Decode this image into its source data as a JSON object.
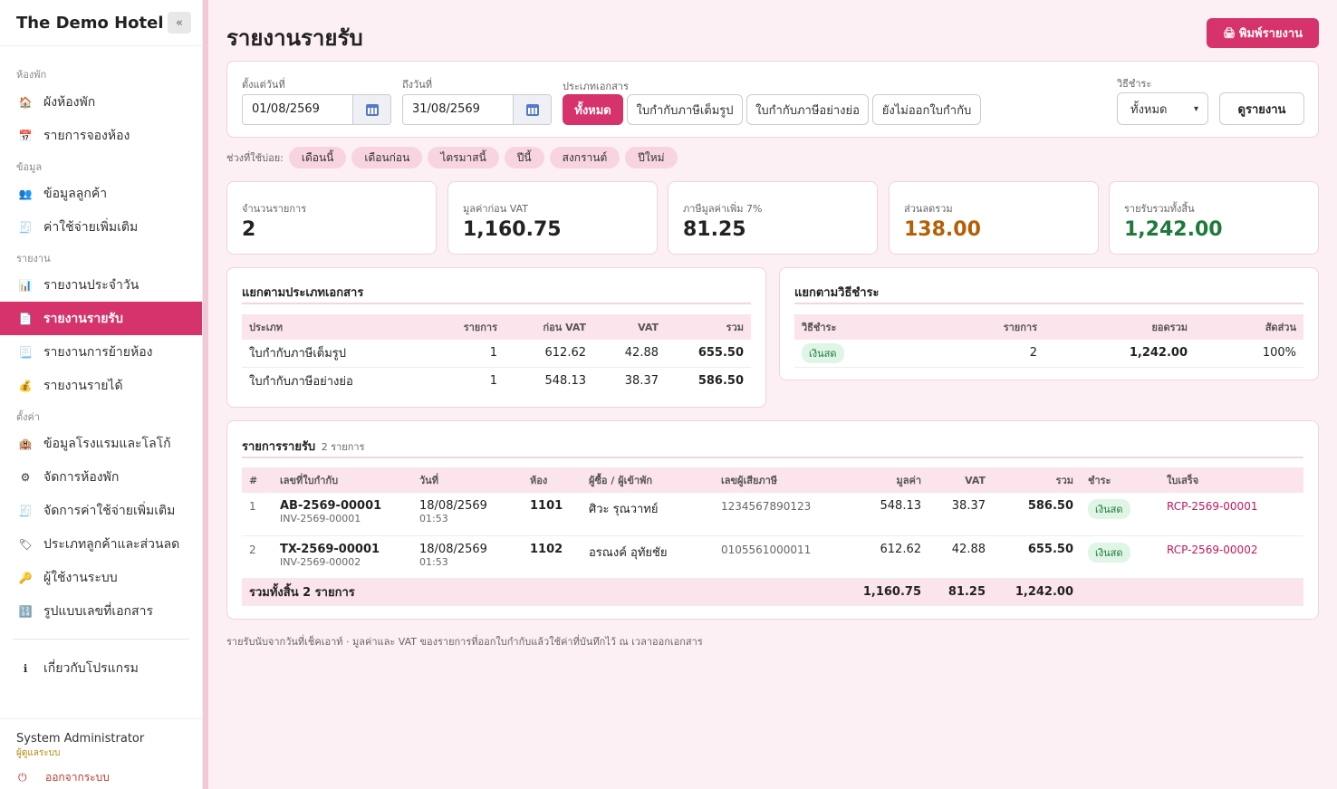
{
  "sidebar": {
    "brand": "The Demo Hotel",
    "collapse": "«",
    "sections": {
      "rooms": "ห้องพัก",
      "data": "ข้อมูล",
      "reports": "รายงาน",
      "settings": "ตั้งค่า"
    },
    "items": {
      "room_chart": "ผังห้องพัก",
      "bookings": "รายการจองห้อง",
      "customers": "ข้อมูลลูกค้า",
      "extra_costs": "ค่าใช้จ่ายเพิ่มเติม",
      "daily_report": "รายงานประจำวัน",
      "receipts_report": "รายงานรายรับ",
      "room_move_report": "รายงานการย้ายห้อง",
      "income_report": "รายงานรายได้",
      "hotel_info": "ข้อมูลโรงแรมและโลโก้",
      "manage_rooms": "จัดการห้องพัก",
      "manage_extra": "จัดการค่าใช้จ่ายเพิ่มเติม",
      "customer_types": "ประเภทลูกค้าและส่วนลด",
      "users": "ผู้ใช้งานระบบ",
      "doc_numbering": "รูปแบบเลขที่เอกสาร",
      "about": "เกี่ยวกับโปรแกรม"
    },
    "user_name": "System Administrator",
    "user_role": "ผู้ดูแลระบบ",
    "logout": "ออกจากระบบ"
  },
  "page": {
    "title": "รายงานรายรับ",
    "print_button": "พิมพ์รายงาน"
  },
  "filters": {
    "from_label": "ตั้งแต่วันที่",
    "from_value": "01/08/2569",
    "to_label": "ถึงวันที่",
    "to_value": "31/08/2569",
    "doc_type_label": "ประเภทเอกสาร",
    "doc_types": [
      "ทั้งหมด",
      "ใบกำกับภาษีเต็มรูป",
      "ใบกำกับภาษีอย่างย่อ",
      "ยังไม่ออกใบกำกับ"
    ],
    "payment_label": "วิธีชำระ",
    "payment_value": "ทั้งหมด",
    "run_button": "ดูรายงาน"
  },
  "quick": {
    "label": "ช่วงที่ใช้บ่อย:",
    "chips": [
      "เดือนนี้",
      "เดือนก่อน",
      "ไตรมาสนี้",
      "ปีนี้",
      "สงกรานต์",
      "ปีใหม่"
    ]
  },
  "stats": [
    {
      "label": "จำนวนรายการ",
      "value": "2",
      "color": "#222222"
    },
    {
      "label": "มูลค่าก่อน VAT",
      "value": "1,160.75",
      "color": "#222222"
    },
    {
      "label": "ภาษีมูลค่าเพิ่ม 7%",
      "value": "81.25",
      "color": "#222222"
    },
    {
      "label": "ส่วนลดรวม",
      "value": "138.00",
      "color": "#b45f06"
    },
    {
      "label": "รายรับรวมทั้งสิ้น",
      "value": "1,242.00",
      "color": "#1e7a3c"
    }
  ],
  "by_doc_type": {
    "title": "แยกตามประเภทเอกสาร",
    "headers": [
      "ประเภท",
      "รายการ",
      "ก่อน VAT",
      "VAT",
      "รวม"
    ],
    "rows": [
      [
        "ใบกำกับภาษีเต็มรูป",
        "1",
        "612.62",
        "42.88",
        "655.50"
      ],
      [
        "ใบกำกับภาษีอย่างย่อ",
        "1",
        "548.13",
        "38.37",
        "586.50"
      ]
    ]
  },
  "by_payment": {
    "title": "แยกตามวิธีชำระ",
    "headers": [
      "วิธีชำระ",
      "รายการ",
      "ยอดรวม",
      "สัดส่วน"
    ],
    "rows": [
      [
        "เงินสด",
        "2",
        "1,242.00",
        "100%"
      ]
    ]
  },
  "receipts": {
    "title": "รายการรายรับ",
    "count_label": "2 รายการ",
    "headers": [
      "#",
      "เลขที่ใบกำกับ",
      "วันที่",
      "ห้อง",
      "ผู้ซื้อ / ผู้เข้าพัก",
      "เลขผู้เสียภาษี",
      "มูลค่า",
      "VAT",
      "รวม",
      "ชำระ",
      "ใบเสร็จ"
    ],
    "rows": [
      {
        "no": "1",
        "doc": "AB-2569-00001",
        "inv": "INV-2569-00001",
        "date": "18/08/2569",
        "time": "01:53",
        "room": "1101",
        "guest": "ศิวะ รุณวาทย์",
        "tax_id": "1234567890123",
        "value": "548.13",
        "vat": "38.37",
        "total": "586.50",
        "pay": "เงินสด",
        "receipt": "RCP-2569-00001"
      },
      {
        "no": "2",
        "doc": "TX-2569-00001",
        "inv": "INV-2569-00002",
        "date": "18/08/2569",
        "time": "01:53",
        "room": "1102",
        "guest": "อรณงค์ อุทัยชัย",
        "tax_id": "0105561000011",
        "value": "612.62",
        "vat": "42.88",
        "total": "655.50",
        "pay": "เงินสด",
        "receipt": "RCP-2569-00002"
      }
    ],
    "total_label": "รวมทั้งสิ้น 2 รายการ",
    "total_value": "1,160.75",
    "total_vat": "81.25",
    "total_sum": "1,242.00"
  },
  "footnote": "รายรับนับจากวันที่เช็คเอาท์ · มูลค่าและ VAT ของรายการที่ออกใบกำกับแล้วใช้ค่าที่บันทึกไว้ ณ เวลาออกเอกสาร"
}
